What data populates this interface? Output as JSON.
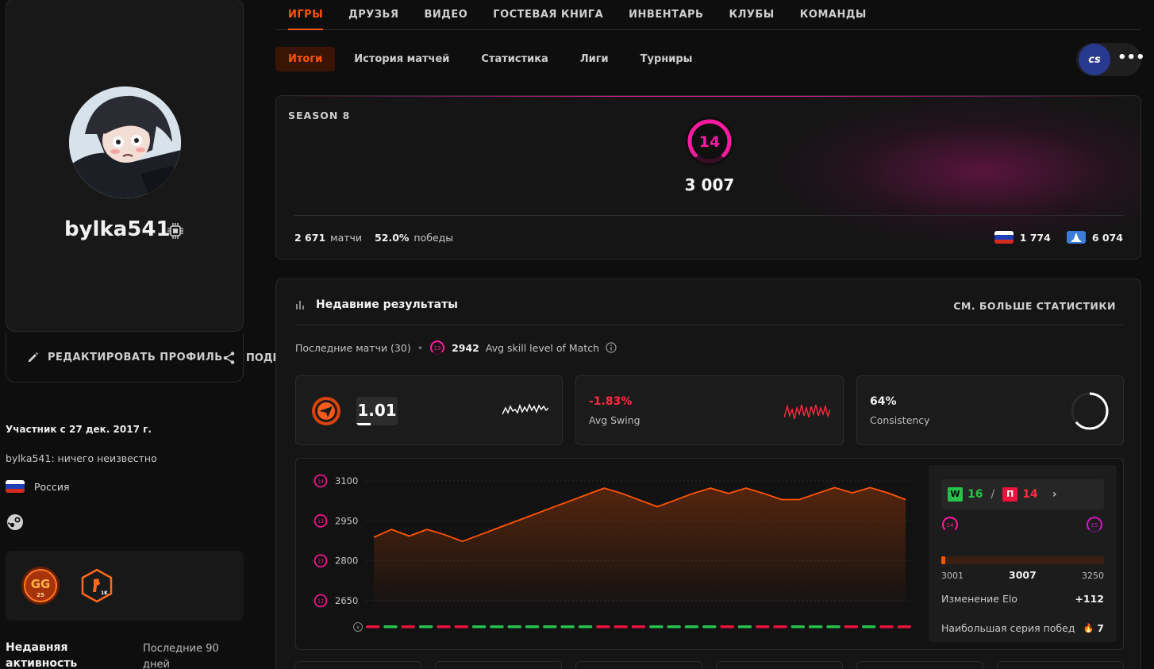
{
  "profile": {
    "username": "bylka541",
    "edit_label": "РЕДАКТИРОВАТЬ ПРОФИЛЬ",
    "share_label": "ПОДЕЛИТЬСЯ",
    "member_since": "Участник с 27 дек. 2017 г.",
    "bio": "bylka541: ничего неизвестно",
    "country": "Россия",
    "recent_activity_label": "Недавняя активность",
    "recent_activity_period": "Последние 90 дней",
    "badge_gg_text": "GG",
    "badge_gg_sub": "25",
    "badge_1k_text": "1K"
  },
  "topnav": {
    "items": [
      "ИГРЫ",
      "ДРУЗЬЯ",
      "ВИДЕО",
      "ГОСТЕВАЯ КНИГА",
      "ИНВЕНТАРЬ",
      "КЛУБЫ",
      "КОМАНДЫ"
    ],
    "active": "ИГРЫ"
  },
  "subnav": {
    "items": [
      "Итоги",
      "История матчей",
      "Статистика",
      "Лиги",
      "Турниры"
    ],
    "active": "Итоги"
  },
  "game_switch": {
    "logo_text": "cs",
    "more": "•••"
  },
  "season": {
    "label": "SEASON 8",
    "level": "14",
    "elo": "3 007",
    "matches_value": "2 671",
    "matches_label": "матчи",
    "winrate_value": "52.0%",
    "winrate_label": "победы",
    "country_rank": "1 774",
    "region_rank": "6 074"
  },
  "recent": {
    "title": "Недавние результаты",
    "see_more": "СМ. БОЛЬШЕ СТАТИСТИКИ",
    "last_matches_label": "Последние матчи (30)",
    "avg_level_badge": "13",
    "avg_skill_value": "2942",
    "avg_skill_label": "Avg skill level of Match",
    "kd_value": "1.01",
    "swing_value": "-1.83%",
    "swing_label": "Avg Swing",
    "consistency_value": "64%",
    "consistency_label": "Consistency",
    "consistency_fraction": 0.64
  },
  "chart_data": {
    "type": "area",
    "y_ticks": [
      {
        "level": "14",
        "value": "3100"
      },
      {
        "level": "13",
        "value": "2950"
      },
      {
        "level": "13",
        "value": "2800"
      },
      {
        "level": "12",
        "value": "2650"
      }
    ],
    "ylim": [
      2650,
      3100
    ],
    "values": [
      2888,
      2918,
      2893,
      2918,
      2898,
      2873,
      2898,
      2923,
      2948,
      2973,
      2998,
      3023,
      3048,
      3073,
      3053,
      3028,
      3003,
      3028,
      3053,
      3073,
      3053,
      3073,
      3053,
      3030,
      3030,
      3053,
      3075,
      3055,
      3075,
      3055,
      3030
    ],
    "results": [
      "L",
      "W",
      "L",
      "W",
      "L",
      "L",
      "W",
      "W",
      "W",
      "W",
      "W",
      "W",
      "W",
      "L",
      "L",
      "L",
      "W",
      "W",
      "W",
      "W",
      "L",
      "W",
      "L",
      "L",
      "W",
      "W",
      "W",
      "L",
      "W",
      "L",
      "L"
    ],
    "colors": {
      "line": "#ff5500",
      "win": "#27c24c",
      "loss": "#e8143c"
    }
  },
  "wl": {
    "wins_label": "W",
    "wins": "16",
    "sep": "/",
    "losses_label": "П",
    "losses": "14",
    "level_from": "14",
    "level_to": "15",
    "range_min": "3001",
    "range_current": "3007",
    "range_max": "3250",
    "progress_fraction": 0.024,
    "elo_change_label": "Изменение Elo",
    "elo_change_value": "+112",
    "streak_label": "Наибольшая серия побед",
    "streak_value": "7"
  }
}
